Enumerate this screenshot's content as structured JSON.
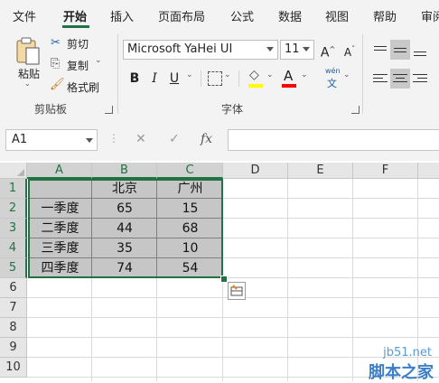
{
  "tabs": [
    "文件",
    "开始",
    "插入",
    "页面布局",
    "公式",
    "数据",
    "视图",
    "帮助",
    "审阅"
  ],
  "clipboard": {
    "paste": "粘贴",
    "cut": "剪切",
    "copy": "复制",
    "format_painter": "格式刷",
    "group_label": "剪贴板"
  },
  "font": {
    "name": "Microsoft YaHei UI",
    "size": "11",
    "grow_icon": "A^",
    "shrink_icon": "Aˇ",
    "bold": "B",
    "italic": "I",
    "underline": "U",
    "fill_color": "#ffff00",
    "font_color": "#ff0000",
    "phonetic_top": "wén",
    "phonetic_bottom": "文",
    "group_label": "字体"
  },
  "formula_bar": {
    "name_box": "A1",
    "cancel": "✕",
    "enter": "✓",
    "fx": "fx",
    "value": ""
  },
  "columns": [
    "A",
    "B",
    "C",
    "D",
    "E",
    "F"
  ],
  "rows": [
    "1",
    "2",
    "3",
    "4",
    "5",
    "6",
    "7",
    "8",
    "9",
    "10"
  ],
  "sheet": {
    "headers": [
      "",
      "北京",
      "广州"
    ],
    "data": [
      [
        "一季度",
        "65",
        "15"
      ],
      [
        "二季度",
        "44",
        "68"
      ],
      [
        "三季度",
        "35",
        "10"
      ],
      [
        "四季度",
        "74",
        "54"
      ]
    ]
  },
  "watermark": {
    "site": "jb51.net",
    "name": "脚本之家"
  },
  "colors": {
    "accent": "#217346",
    "selection_fill": "#c6c6c6"
  }
}
